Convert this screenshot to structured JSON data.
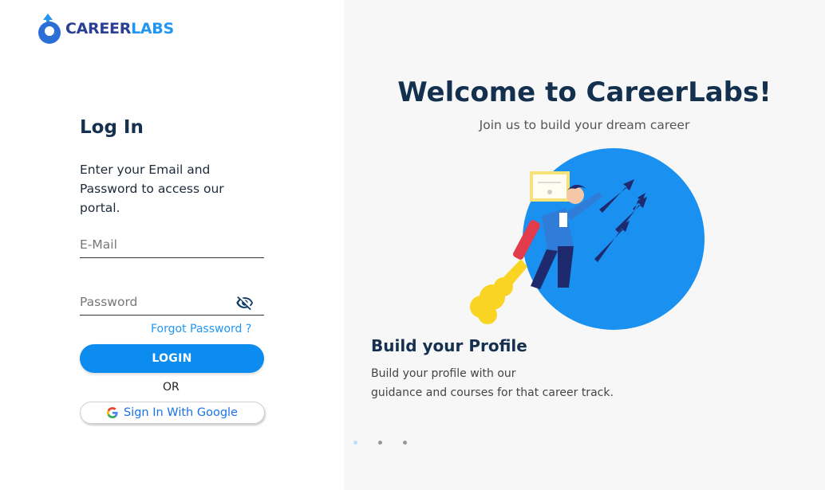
{
  "brand": {
    "name_part1": "CAREER",
    "name_part2": "LABS",
    "primary_color": "#2b3f94",
    "accent_color": "#2196f3",
    "logo_icon": "rocket-drop-logo-icon"
  },
  "login": {
    "title": "Log In",
    "description": "Enter your Email and Password to access our portal.",
    "email": {
      "placeholder": "E-Mail",
      "value": ""
    },
    "password": {
      "placeholder": "Password",
      "value": "",
      "toggle_icon": "eye-off-icon"
    },
    "forgot_label": "Forgot Password ?",
    "submit_label": "LOGIN",
    "separator": "OR",
    "google_label": "Sign In With Google",
    "google_icon": "google-g-icon",
    "button_color": "#0d8cf0"
  },
  "hero": {
    "title": "Welcome to CareerLabs!",
    "subtitle": "Join us to build your dream career",
    "illustration_icon": "jetpack-person-illustration",
    "slide": {
      "title": "Build your Profile",
      "description_line1": "Build your profile with our",
      "description_line2": "guidance and courses for that career track."
    },
    "carousel": {
      "count": 3,
      "active_index": 0
    }
  }
}
